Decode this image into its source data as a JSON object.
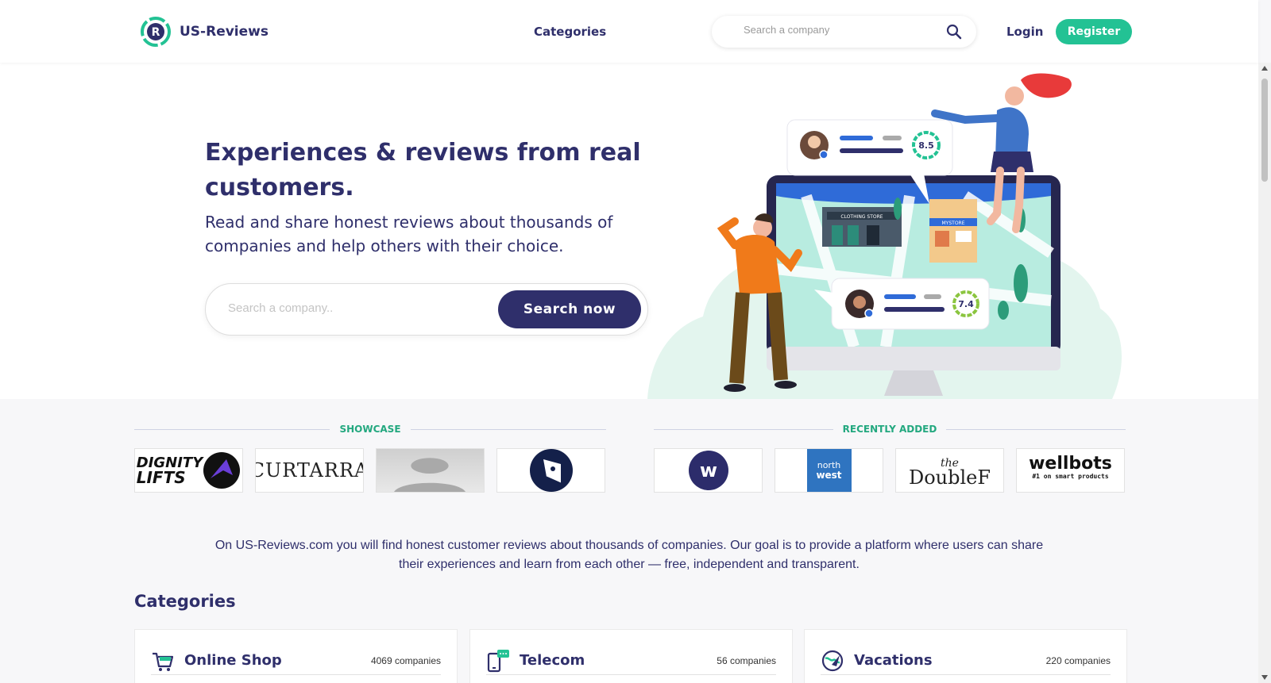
{
  "brand": {
    "name": "US-Reviews",
    "logo_letter": "R",
    "primary_color": "#2f2f6b",
    "accent_color": "#23c294"
  },
  "header": {
    "nav_categories": "Categories",
    "search_placeholder": "Search a company",
    "search_icon": "search-icon",
    "login_label": "Login",
    "register_label": "Register"
  },
  "hero": {
    "title": "Experiences & reviews from real customers.",
    "subtitle": "Read and share honest reviews about thousands of companies and help others with their choice.",
    "search_placeholder": "Search a company..",
    "search_button": "Search now",
    "illustration": {
      "store_sign_1": "CLOTHING STORE",
      "store_sign_2": "MYSTORE",
      "rating_1": "8.5",
      "rating_2": "7.4"
    }
  },
  "showcase": {
    "label": "SHOWCASE",
    "logos": [
      {
        "name": "dignity-lifts-logo",
        "line1": "DIGNITY",
        "line2": "LIFTS"
      },
      {
        "name": "curtarra-logo",
        "text": "CURTARRA"
      },
      {
        "name": "placeholder-logo",
        "text": ""
      },
      {
        "name": "bird-circle-logo",
        "text": ""
      }
    ]
  },
  "recently_added": {
    "label": "RECENTLY ADDED",
    "logos": [
      {
        "name": "w-circle-logo",
        "text": "w"
      },
      {
        "name": "north-west-logo",
        "line1": "north",
        "line2": "west"
      },
      {
        "name": "the-double-f-logo",
        "line1": "the",
        "line2": "DoubleF"
      },
      {
        "name": "wellbots-logo",
        "line1": "wellbots",
        "line2": "#1 on smart products"
      }
    ]
  },
  "intro_text": "On US-Reviews.com you will find honest customer reviews about thousands of companies. Our goal is to provide a platform where users can share their experiences and learn from each other — free, independent and transparent.",
  "categories": {
    "title": "Categories",
    "items": [
      {
        "name": "Online Shop",
        "count": "4069 companies",
        "icon": "shopping-cart-icon"
      },
      {
        "name": "Telecom",
        "count": "56 companies",
        "icon": "phone-chat-icon"
      },
      {
        "name": "Vacations",
        "count": "220 companies",
        "icon": "globe-plane-icon"
      }
    ]
  }
}
